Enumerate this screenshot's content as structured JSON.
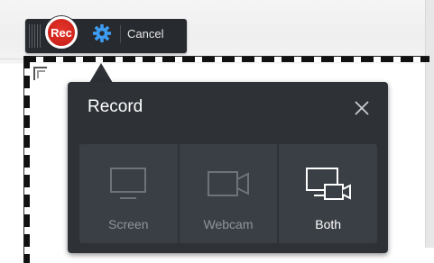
{
  "toolbar": {
    "rec_label": "Rec",
    "cancel_label": "Cancel",
    "icons": {
      "grip": "grip-icon",
      "settings": "gear-icon"
    }
  },
  "popup": {
    "title": "Record",
    "close_icon": "close-icon",
    "options": [
      {
        "label": "Screen",
        "icon": "monitor-icon",
        "active": false
      },
      {
        "label": "Webcam",
        "icon": "webcam-icon",
        "active": false
      },
      {
        "label": "Both",
        "icon": "monitor-webcam-icon",
        "active": true
      }
    ]
  },
  "colors": {
    "rec_red": "#d2251d",
    "gear_blue": "#3d9bf0",
    "panel_dark": "#2e3237",
    "option_bg": "#3a3f45",
    "inactive_text": "#8e949a",
    "active_text": "#ffffff"
  }
}
